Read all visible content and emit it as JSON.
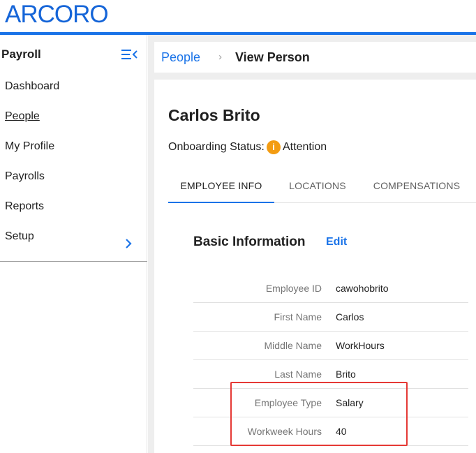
{
  "brand": {
    "logo_text": "ARCORO",
    "accent": "#1a73e8",
    "logo_color": "#1565d8"
  },
  "sidebar": {
    "title": "Payroll",
    "collapse_icon": "menu-collapse-icon",
    "items": [
      {
        "label": "Dashboard",
        "active": false
      },
      {
        "label": "People",
        "active": true
      },
      {
        "label": "My Profile",
        "active": false
      },
      {
        "label": "Payrolls",
        "active": false
      },
      {
        "label": "Reports",
        "active": false
      },
      {
        "label": "Setup",
        "active": false,
        "icon": "chevron-right-icon"
      }
    ]
  },
  "breadcrumb": {
    "parent": "People",
    "separator": "›",
    "current": "View Person"
  },
  "person": {
    "name": "Carlos Brito",
    "status_label": "Onboarding Status:",
    "status_icon": "i",
    "status_value": "Attention",
    "status_color": "#f39c12"
  },
  "tabs": [
    {
      "label": "EMPLOYEE INFO",
      "active": true
    },
    {
      "label": "LOCATIONS",
      "active": false
    },
    {
      "label": "COMPENSATIONS",
      "active": false
    }
  ],
  "basic_info": {
    "title": "Basic Information",
    "edit_label": "Edit",
    "rows": [
      {
        "label": "Employee ID",
        "value": "cawohobrito"
      },
      {
        "label": "First Name",
        "value": "Carlos"
      },
      {
        "label": "Middle Name",
        "value": "WorkHours"
      },
      {
        "label": "Last Name",
        "value": "Brito"
      },
      {
        "label": "Employee Type",
        "value": "Salary"
      },
      {
        "label": "Workweek Hours",
        "value": "40"
      }
    ]
  },
  "highlight_color": "#e53935"
}
